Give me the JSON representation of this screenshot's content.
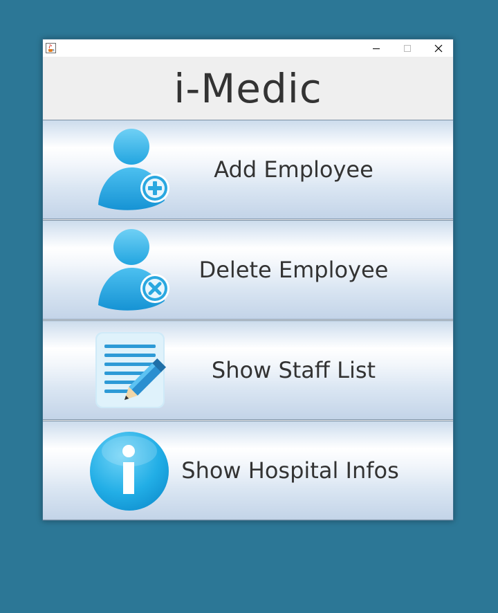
{
  "window": {
    "app_icon": "java-coffee-icon",
    "controls": {
      "minimize_icon": "minimize-icon",
      "maximize_icon": "maximize-icon",
      "close_icon": "close-icon"
    }
  },
  "header": {
    "title": "i-Medic"
  },
  "menu": {
    "items": [
      {
        "label": "Add Employee",
        "icon": "add-user-icon"
      },
      {
        "label": "Delete Employee",
        "icon": "remove-user-icon"
      },
      {
        "label": "Show Staff List",
        "icon": "staff-list-icon"
      },
      {
        "label": "Show Hospital Infos",
        "icon": "info-icon"
      }
    ]
  },
  "colors": {
    "desktop": "#2c7796",
    "icon_blue": "#1ea3df",
    "icon_light": "#5fc4f0",
    "text": "#333333"
  }
}
